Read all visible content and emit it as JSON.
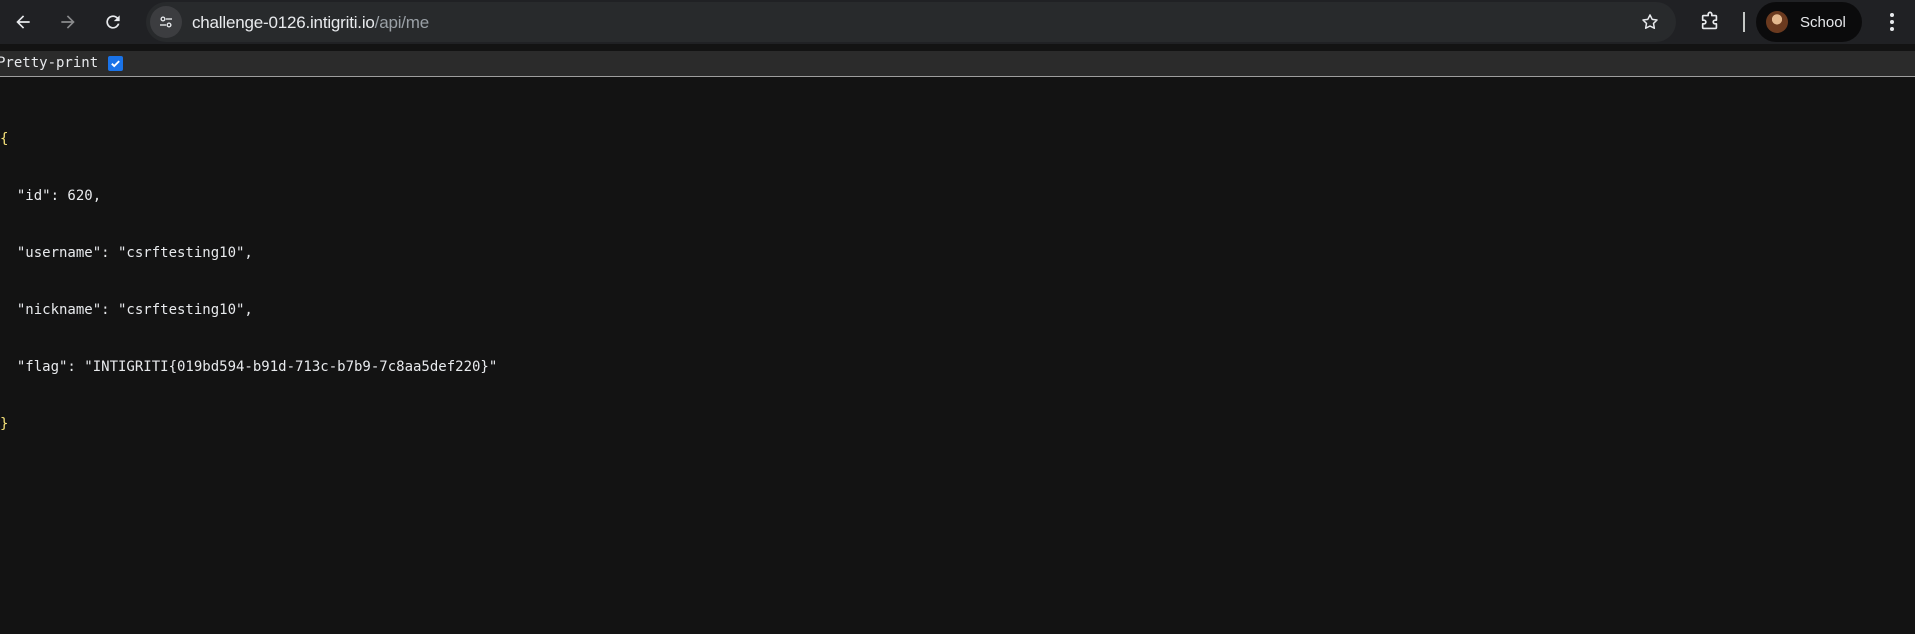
{
  "browser": {
    "back_icon": "arrow-left-icon",
    "forward_icon": "arrow-right-icon",
    "reload_icon": "reload-icon",
    "url_host": "challenge-0126.intigriti.io",
    "url_path": "/api/me",
    "bookmark_icon": "star-icon",
    "extensions_icon": "puzzle-icon",
    "profile_label": "School",
    "menu_icon": "kebab-menu-icon"
  },
  "prettyprint": {
    "label": "Pretty-print",
    "checked": true
  },
  "json": {
    "open": "{",
    "lines": [
      "  \"id\": 620,",
      "  \"username\": \"csrftesting10\",",
      "  \"nickname\": \"csrftesting10\",",
      "  \"flag\": \"INTIGRITI{019bd594-b91d-713c-b7b9-7c8aa5def220}\""
    ],
    "close": "}"
  }
}
